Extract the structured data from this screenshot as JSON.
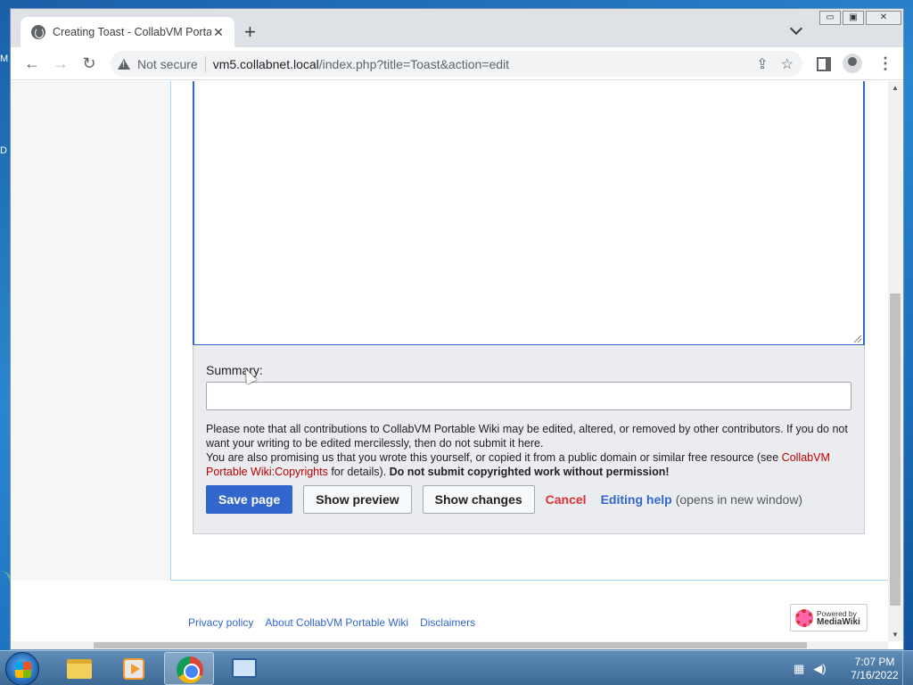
{
  "browser": {
    "tab": {
      "title": "Creating Toast - CollabVM Portable Wiki",
      "close_glyph": "✕"
    },
    "new_tab_glyph": "+",
    "window_controls": {
      "minimize": "▭",
      "maximize": "▣",
      "close": "✕"
    },
    "toolbar": {
      "back_glyph": "←",
      "forward_glyph": "→",
      "reload_glyph": "↻",
      "security_label": "Not secure",
      "url_host": "vm5.collabnet.local",
      "url_path": "/index.php?title=Toast&action=edit",
      "share_glyph": "⇪",
      "bookmark_glyph": "☆",
      "menu_glyph": "⋮"
    }
  },
  "editor": {
    "summary_label": "Summary:",
    "summary_value": "",
    "copyright_warning": {
      "line1": "Please note that all contributions to CollabVM Portable Wiki may be edited, altered, or removed by other contributors. If you do not want your writing to be edited mercilessly, then do not submit it here.",
      "line2_prefix": "You are also promising us that you wrote this yourself, or copied it from a public domain or similar free resource (see ",
      "copyrights_link": "CollabVM Portable Wiki:Copyrights",
      "line2_suffix": " for details). ",
      "bold_warning": "Do not submit copyrighted work without permission!"
    },
    "buttons": {
      "save": "Save page",
      "preview": "Show preview",
      "changes": "Show changes",
      "cancel": "Cancel",
      "help": "Editing help",
      "help_note": "(opens in new window)"
    }
  },
  "footer": {
    "links": [
      "Privacy policy",
      "About CollabVM Portable Wiki",
      "Disclaimers"
    ],
    "powered_by": "Powered by",
    "mediawiki": "MediaWiki"
  },
  "scrollbar": {
    "vertical_position": 0.9
  },
  "desktop": {
    "fragment_m": "M",
    "fragment_d": "D"
  },
  "taskbar": {
    "apps": [
      "explorer-icon",
      "media-player-icon",
      "chrome-icon",
      "remote-desktop-icon"
    ],
    "active_app": "chrome-icon",
    "tray_icons": [
      "network-icon",
      "volume-icon"
    ],
    "time": "7:07 PM",
    "date": "7/16/2022"
  },
  "colors": {
    "link_blue": "#3366cc",
    "link_red": "#ba0000",
    "cancel_red": "#dd3333",
    "primary_button": "#3366cc",
    "options_panel": "#eaecf0"
  }
}
